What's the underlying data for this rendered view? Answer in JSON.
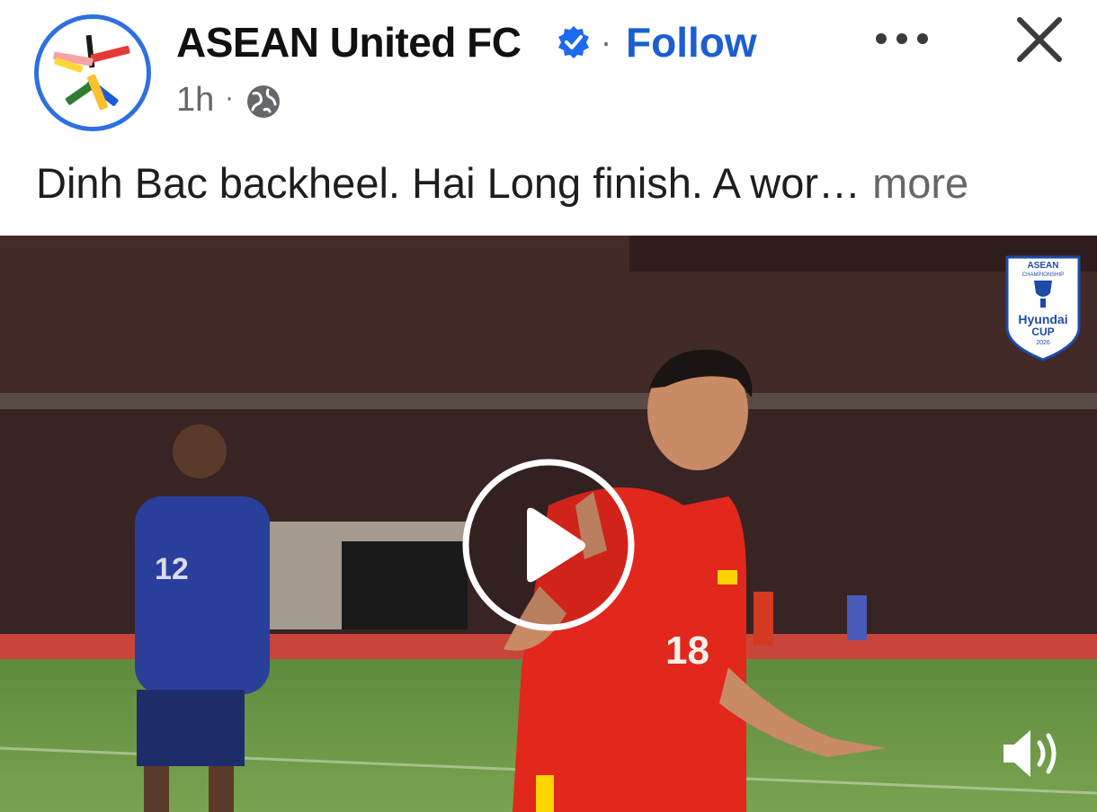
{
  "post": {
    "page_name": "ASEAN United FC",
    "separator": "·",
    "follow_label": "Follow",
    "time": "1h",
    "time_separator": "·",
    "caption_text": "Dinh Bac backheel. Hai Long finish. A wor…",
    "caption_more": "more"
  },
  "video": {
    "badge": {
      "line1": "ASEAN",
      "line2": "CHAMPIONSHIP",
      "brand": "Hyundai",
      "cup": "CUP",
      "year": "2026"
    },
    "player_red_number": "18",
    "player_blue_number": "12"
  },
  "colors": {
    "follow": "#1b5fcf",
    "verified": "#1b6af0",
    "avatar_ring": "#2f6fe0"
  },
  "icons": [
    "verified-badge-icon",
    "more-options-icon",
    "close-icon",
    "globe-icon",
    "play-icon",
    "sound-icon"
  ]
}
